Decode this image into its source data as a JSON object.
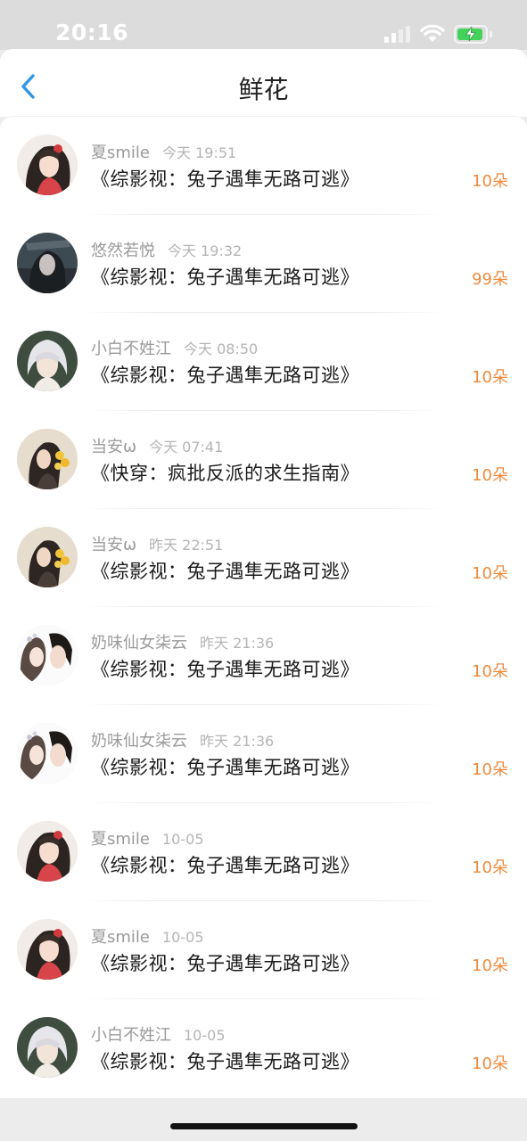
{
  "status_bar": {
    "time": "20:16",
    "icons": [
      "cellular-signal-icon",
      "wifi-icon",
      "battery-charging-icon"
    ],
    "battery_level": 0.85,
    "colors": {
      "battery": "#43d35b"
    }
  },
  "nav": {
    "title": "鲜花",
    "back_icon": "chevron-left-icon",
    "colors": {
      "back": "#2d97e6"
    }
  },
  "colors": {
    "amount": "#ef8a3c",
    "name": "#9a9a9a",
    "time": "#b4b4b4",
    "book": "#1a1a1a"
  },
  "items": [
    {
      "name": "夏smile",
      "time": "今天 19:51",
      "book": "《综影视：兔子遇隼无路可逃》",
      "amount": "10朵",
      "avatar": "avatar-girl-red-flower"
    },
    {
      "name": "悠然若悦",
      "time": "今天 19:32",
      "book": "《综影视：兔子遇隼无路可逃》",
      "amount": "99朵",
      "avatar": "avatar-dark-portrait"
    },
    {
      "name": "小白不姓江",
      "time": "今天 08:50",
      "book": "《综影视：兔子遇隼无路可逃》",
      "amount": "10朵",
      "avatar": "avatar-silver-hair"
    },
    {
      "name": "当安ω",
      "time": "今天 07:41",
      "book": "《快穿：疯批反派的求生指南》",
      "amount": "10朵",
      "avatar": "avatar-girl-yellow-flowers"
    },
    {
      "name": "当安ω",
      "time": "昨天 22:51",
      "book": "《综影视：兔子遇隼无路可逃》",
      "amount": "10朵",
      "avatar": "avatar-girl-yellow-flowers"
    },
    {
      "name": "奶味仙女柒云",
      "time": "昨天 21:36",
      "book": "《综影视：兔子遇隼无路可逃》",
      "amount": "10朵",
      "avatar": "avatar-couple"
    },
    {
      "name": "奶味仙女柒云",
      "time": "昨天 21:36",
      "book": "《综影视：兔子遇隼无路可逃》",
      "amount": "10朵",
      "avatar": "avatar-couple"
    },
    {
      "name": "夏smile",
      "time": "10-05",
      "book": "《综影视：兔子遇隼无路可逃》",
      "amount": "10朵",
      "avatar": "avatar-girl-red-flower"
    },
    {
      "name": "夏smile",
      "time": "10-05",
      "book": "《综影视：兔子遇隼无路可逃》",
      "amount": "10朵",
      "avatar": "avatar-girl-red-flower"
    },
    {
      "name": "小白不姓江",
      "time": "10-05",
      "book": "《综影视：兔子遇隼无路可逃》",
      "amount": "10朵",
      "avatar": "avatar-silver-hair"
    }
  ]
}
